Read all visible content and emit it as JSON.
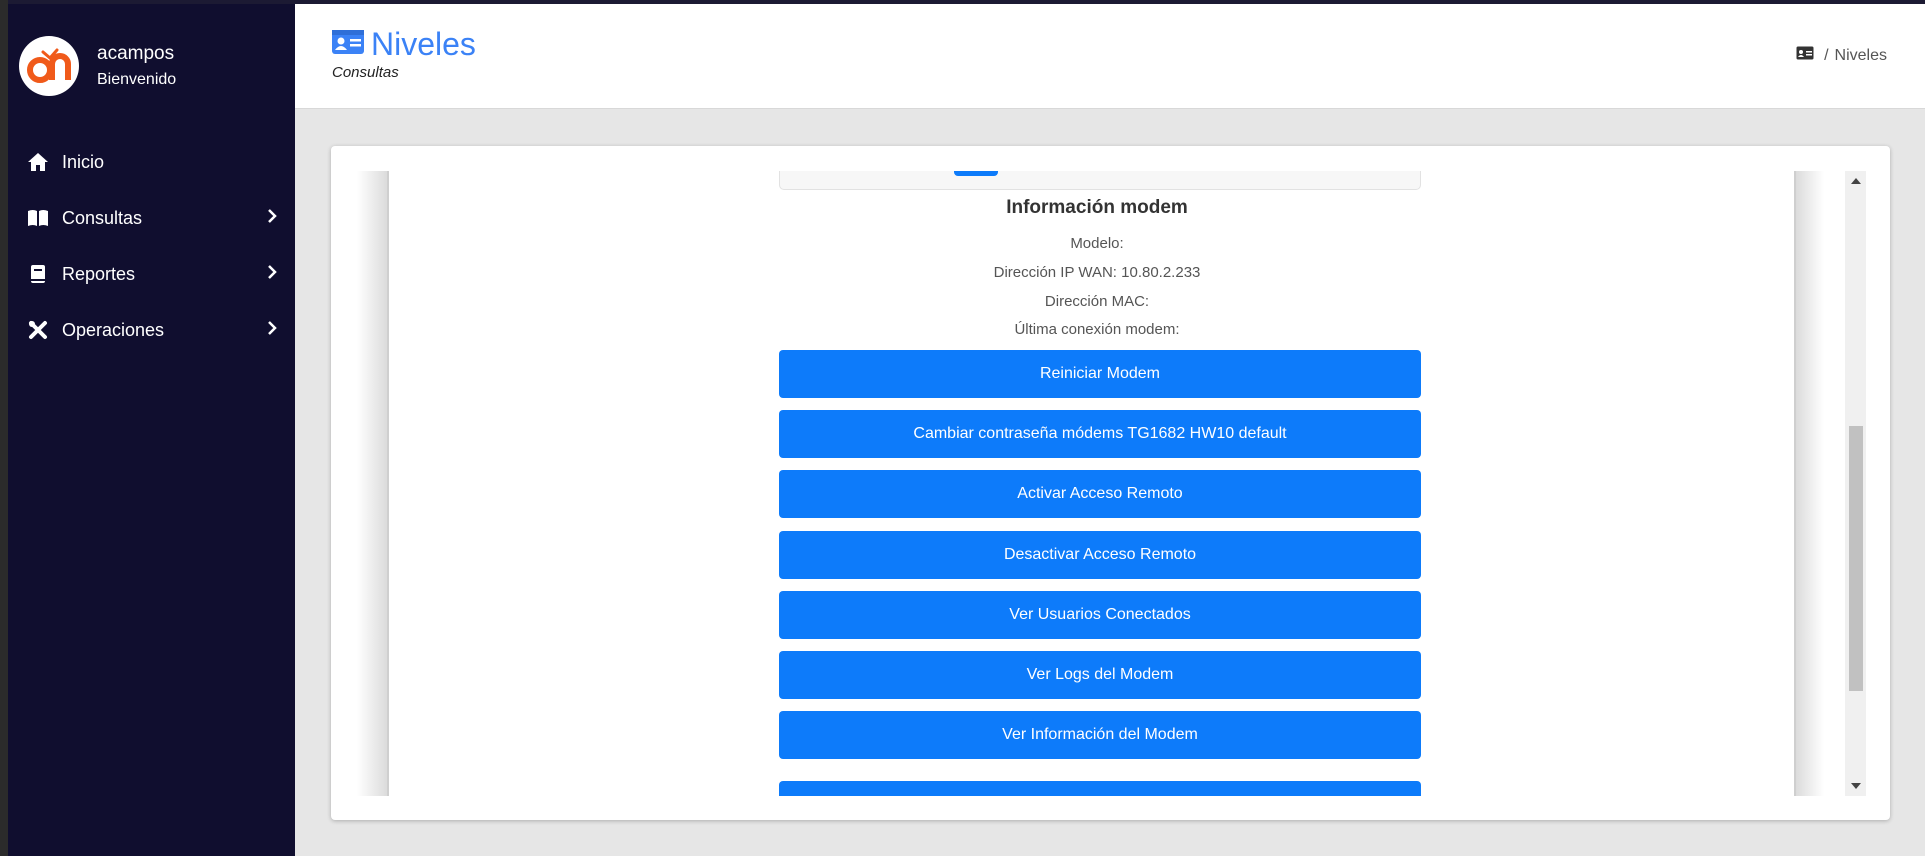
{
  "user": {
    "name": "acampos",
    "greeting": "Bienvenido"
  },
  "nav": [
    {
      "label": "Inicio",
      "icon": "home-icon",
      "has_submenu": false
    },
    {
      "label": "Consultas",
      "icon": "book-icon",
      "has_submenu": true
    },
    {
      "label": "Reportes",
      "icon": "notebook-icon",
      "has_submenu": true
    },
    {
      "label": "Operaciones",
      "icon": "tools-icon",
      "has_submenu": true
    }
  ],
  "header": {
    "title": "Niveles",
    "subtitle": "Consultas",
    "title_icon": "id-card-icon",
    "breadcrumb": {
      "icon": "id-card-icon",
      "separator": "/",
      "current": "Niveles"
    }
  },
  "modem_info": {
    "title": "Información modem",
    "model": "Modelo:",
    "wan_ip": "Dirección IP WAN: 10.80.2.233",
    "mac": "Dirección MAC:",
    "last_connection": "Última conexión modem:"
  },
  "actions": [
    "Reiniciar Modem",
    "Cambiar contraseña módems TG1682 HW10 default",
    "Activar Acceso Remoto",
    "Desactivar Acceso Remoto",
    "Ver Usuarios Conectados",
    "Ver Logs del Modem",
    "Ver Información del Modem",
    ""
  ],
  "colors": {
    "sidebar_bg": "#100e2f",
    "accent": "#3b82f6",
    "button": "#0d7bfa",
    "logo_orange": "#f05a1a"
  }
}
